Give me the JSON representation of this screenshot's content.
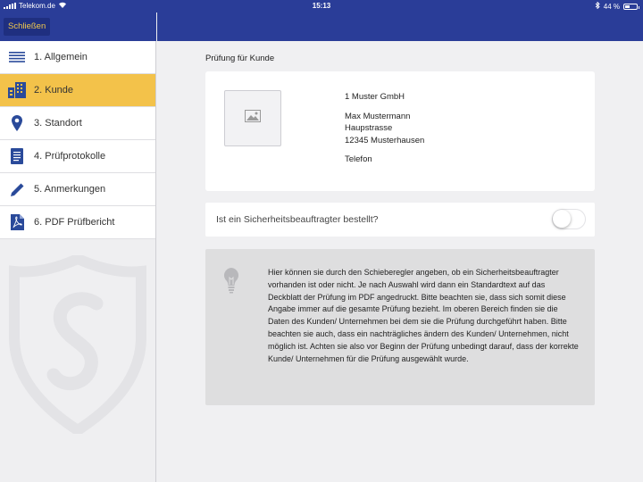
{
  "status_bar": {
    "carrier": "Telekom.de",
    "time": "15:13",
    "battery": "44 %",
    "battery_level": 0.44
  },
  "nav": {
    "close_label": "Schließen"
  },
  "sidebar": {
    "items": [
      {
        "label": "1. Allgemein",
        "icon": "list-icon",
        "active": false
      },
      {
        "label": "2. Kunde",
        "icon": "building-icon",
        "active": true
      },
      {
        "label": "3. Standort",
        "icon": "location-pin-icon",
        "active": false
      },
      {
        "label": "4. Prüfprotokolle",
        "icon": "document-icon",
        "active": false
      },
      {
        "label": "5. Anmerkungen",
        "icon": "pencil-icon",
        "active": false
      },
      {
        "label": "6. PDF Prüfbericht",
        "icon": "pdf-icon",
        "active": false
      }
    ]
  },
  "main": {
    "section_title": "Prüfung für Kunde",
    "customer": {
      "company": "1 Muster GmbH",
      "contact": "Max Mustermann",
      "street": "Haupstrasse",
      "city": "12345 Musterhausen",
      "phone": "Telefon"
    },
    "toggle": {
      "label": "Ist ein Sicherheitsbeauftragter bestellt?",
      "value": false
    },
    "info_text": "Hier können sie durch den Schieberegler angeben, ob ein Sicherheitsbeauftragter vorhanden ist oder nicht. Je nach Auswahl wird dann ein Standardtext auf das Deckblatt der Prüfung im PDF angedruckt. Bitte beachten sie, dass sich somit diese Angabe immer auf die gesamte Prüfung bezieht. Im oberen Bereich finden sie die Daten des Kunden/ Unternehmen bei dem sie die Prüfung durchgeführt haben. Bitte beachten sie auch, dass ein nachträgliches ändern des Kunden/ Unternehmen, nicht möglich ist. Achten sie also vor Beginn der Prüfung unbedingt darauf, dass der korrekte Kunde/ Unternehmen für die Prüfung ausgewählt wurde."
  },
  "colors": {
    "nav_blue": "#2a3d98",
    "active_yellow": "#f3c24a",
    "close_text": "#f2c94c",
    "icon_blue": "#2a4a9a"
  }
}
